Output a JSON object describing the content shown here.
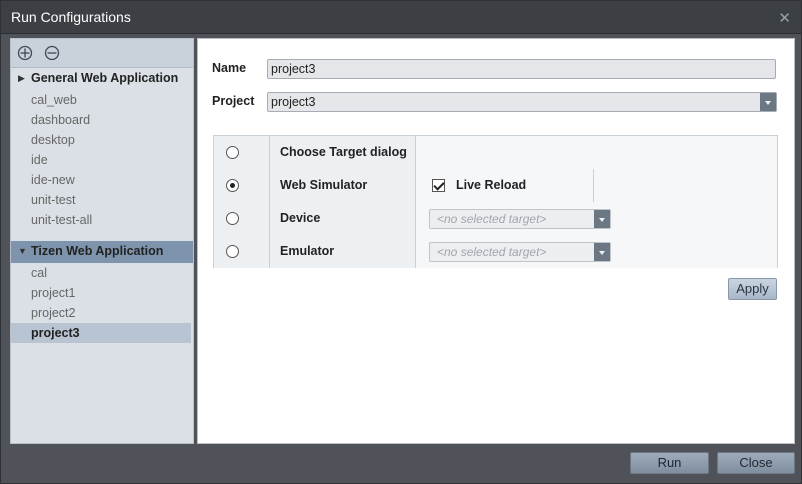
{
  "window": {
    "title": "Run Configurations",
    "close_icon": "close-icon"
  },
  "tree": {
    "toolbar": {
      "add_icon": "add-circle-icon",
      "remove_icon": "remove-circle-icon"
    },
    "groups": [
      {
        "label": "General Web Application",
        "items": [
          "cal_web",
          "dashboard",
          "desktop",
          "ide",
          "ide-new",
          "unit-test",
          "unit-test-all"
        ]
      },
      {
        "label": "Tizen Web Application",
        "items": [
          "cal",
          "project1",
          "project2",
          "project3"
        ]
      }
    ],
    "selected_item": "project3"
  },
  "form": {
    "name_label": "Name",
    "name_value": "project3",
    "project_label": "Project",
    "project_value": "project3"
  },
  "targets": [
    {
      "label": "Choose Target dialog",
      "selected": false
    },
    {
      "label": "Web Simulator",
      "selected": true,
      "option_label": "Live Reload",
      "option_checked": true
    },
    {
      "label": "Device",
      "selected": false,
      "placeholder": "<no selected target>"
    },
    {
      "label": "Emulator",
      "selected": false,
      "placeholder": "<no selected target>"
    }
  ],
  "buttons": {
    "apply": "Apply",
    "run": "Run",
    "close": "Close"
  },
  "colors": {
    "title_bar": "#3c4045",
    "selection": "#7e94ad",
    "button": "#a8b8c9"
  }
}
